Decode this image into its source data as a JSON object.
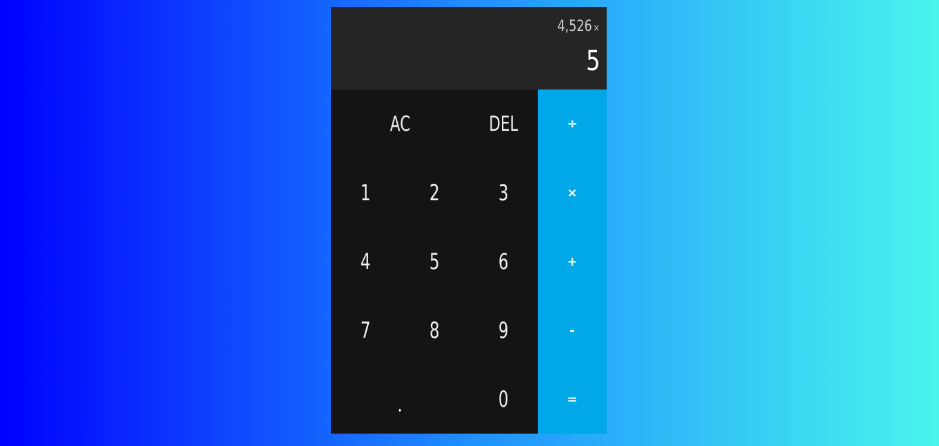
{
  "display": {
    "previous_value": "4,526",
    "previous_operator": "×",
    "current_value": "5"
  },
  "keys": {
    "clear": "AC",
    "delete": "DEL",
    "divide": "÷",
    "multiply": "×",
    "add": "+",
    "subtract": "-",
    "equals": "=",
    "decimal": ".",
    "digits": [
      "0",
      "1",
      "2",
      "3",
      "4",
      "5",
      "6",
      "7",
      "8",
      "9"
    ]
  },
  "colors": {
    "background_gradient": [
      "#0000ff",
      "#1e90ff",
      "#48f5ec"
    ],
    "display_bg": "#252525",
    "keypad_bg": "#141414",
    "operator_bg": "#00a8e8"
  }
}
